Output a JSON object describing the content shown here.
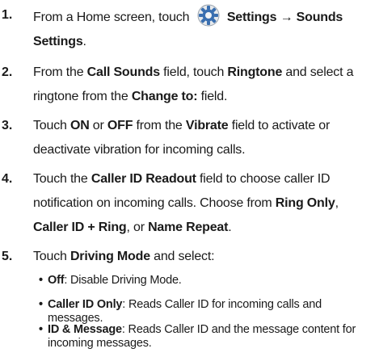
{
  "steps": [
    {
      "number": "1.",
      "parts": [
        "From a Home screen, touch",
        "Settings",
        "→",
        "Sounds Settings",
        "."
      ],
      "icon": "settings-gear-icon"
    },
    {
      "number": "2.",
      "parts": [
        "From the ",
        "Call Sounds",
        " field, touch ",
        "Ringtone",
        " and select a ringtone from the ",
        "Change to:",
        " field."
      ]
    },
    {
      "number": "3.",
      "parts": [
        "Touch ",
        "ON",
        " or ",
        "OFF",
        " from the ",
        "Vibrate",
        " field to activate or deactivate vibration for incoming calls."
      ]
    },
    {
      "number": "4.",
      "parts": [
        "Touch the ",
        "Caller ID Readout",
        " field to choose caller ID notification on incoming calls. Choose from ",
        "Ring Only",
        ",",
        "Caller ID + Ring",
        ", or ",
        "Name Repeat",
        "."
      ]
    },
    {
      "number": "5.",
      "parts": [
        "Touch ",
        "Driving Mode",
        " and select:"
      ]
    }
  ],
  "bullets": [
    {
      "term": "Off",
      "text": ": Disable Driving Mode."
    },
    {
      "term": "Caller ID Only",
      "text": ": Reads Caller ID for incoming calls and messages."
    },
    {
      "term": "ID & Message",
      "text": ": Reads Caller ID and the message content for incoming messages."
    }
  ],
  "bullet_char": "•",
  "colors": {
    "text": "#1a1a1a",
    "icon_blue": "#3a6fb0",
    "icon_ring": "#9aa3ad"
  }
}
